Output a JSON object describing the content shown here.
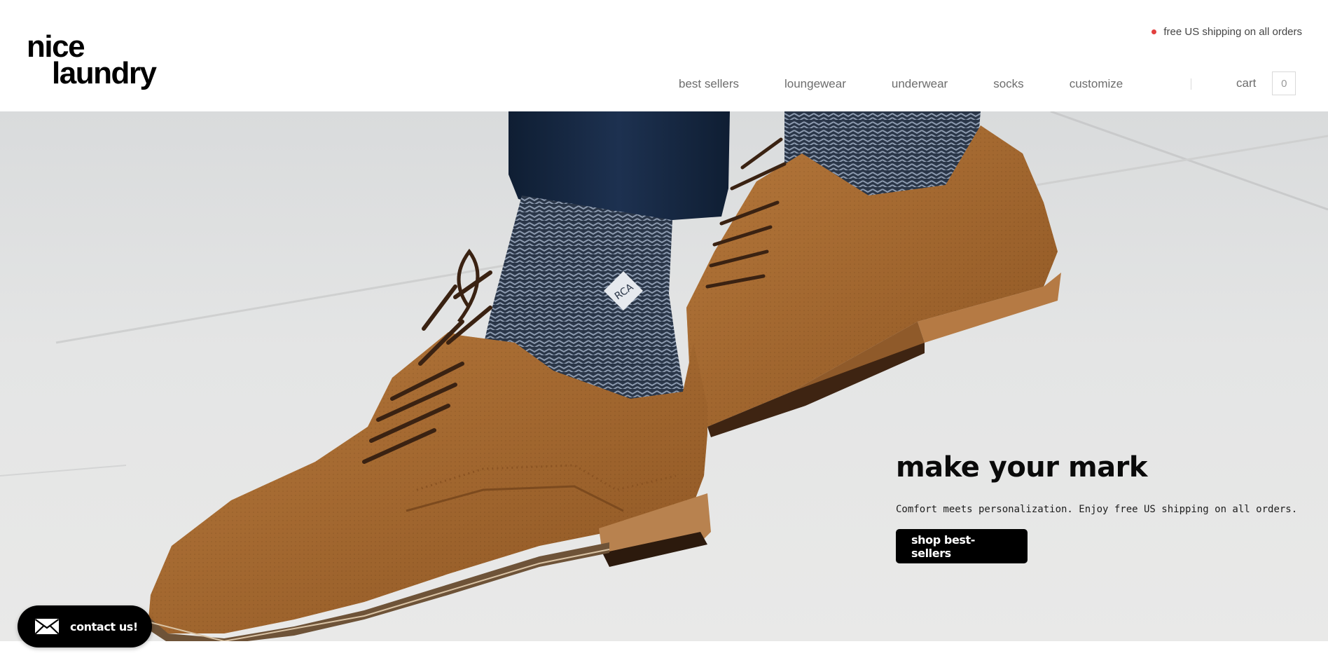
{
  "brand": {
    "logo_line1": "nice",
    "logo_line2": "laundry"
  },
  "promo": {
    "text": "free US shipping on all orders",
    "dot_color": "#e2403f"
  },
  "nav": {
    "items": [
      {
        "label": "best sellers"
      },
      {
        "label": "loungewear"
      },
      {
        "label": "underwear"
      },
      {
        "label": "socks"
      },
      {
        "label": "customize"
      }
    ]
  },
  "cart": {
    "label": "cart",
    "count": "0"
  },
  "hero": {
    "title": "make your mark",
    "subtitle": "Comfort meets personalization. Enjoy free US shipping on all orders.",
    "cta_label": "shop best-sellers",
    "sock_monogram": "RCA"
  },
  "contact": {
    "label": "contact us!",
    "icon": "mail-icon"
  },
  "colors": {
    "accent": "#000000",
    "shoe": "#a9692e",
    "sock": "#2b3a4e",
    "pavement": "#e2e3e3"
  }
}
